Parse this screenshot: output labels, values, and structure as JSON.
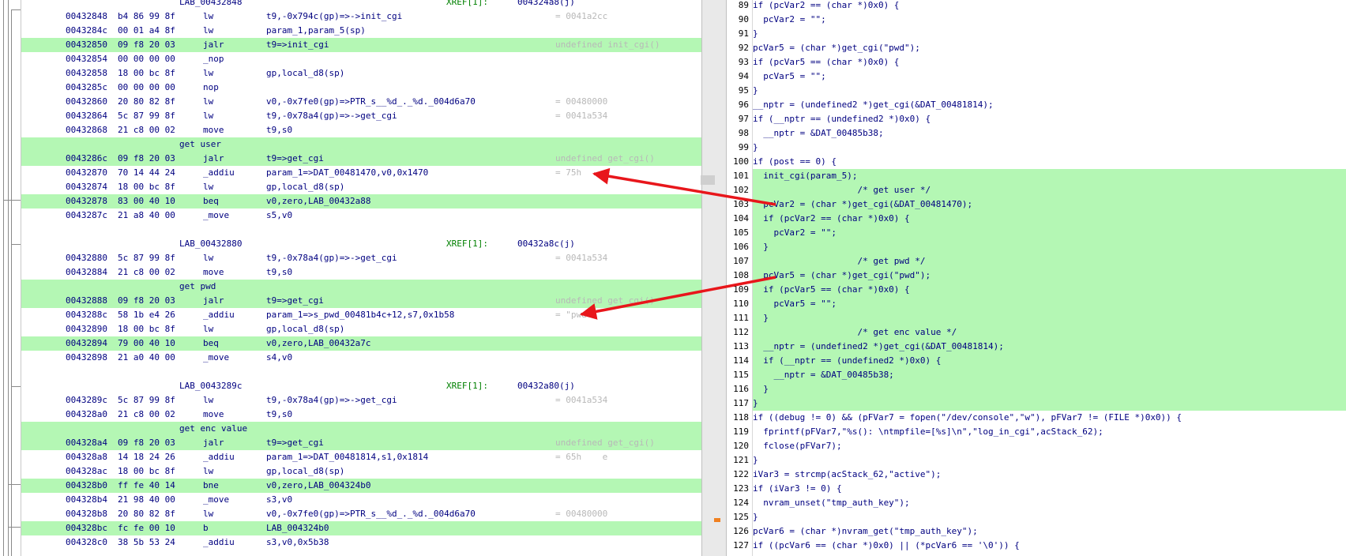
{
  "listing": [
    {
      "type": "label",
      "label": "LAB_00432848",
      "xref": "XREF[1]:",
      "xref_addr": "004324a8(j)"
    },
    {
      "type": "instr",
      "addr": "00432848",
      "bytes": "b4 86 99 8f",
      "mnemonic": "lw",
      "operands": "t9,-0x794c(gp)=>->init_cgi",
      "comment": "= 0041a2cc",
      "hl": false
    },
    {
      "type": "instr",
      "addr": "0043284c",
      "bytes": "00 01 a4 8f",
      "mnemonic": "lw",
      "operands": "param_1,param_5(sp)",
      "comment": "",
      "hl": false
    },
    {
      "type": "instr",
      "addr": "00432850",
      "bytes": "09 f8 20 03",
      "mnemonic": "jalr",
      "operands": "t9=>init_cgi",
      "comment": "undefined init_cgi()",
      "hl": true
    },
    {
      "type": "instr",
      "addr": "00432854",
      "bytes": "00 00 00 00",
      "mnemonic": "_nop",
      "operands": "",
      "comment": "",
      "hl": false
    },
    {
      "type": "instr",
      "addr": "00432858",
      "bytes": "18 00 bc 8f",
      "mnemonic": "lw",
      "operands": "gp,local_d8(sp)",
      "comment": "",
      "hl": false
    },
    {
      "type": "instr",
      "addr": "0043285c",
      "bytes": "00 00 00 00",
      "mnemonic": "nop",
      "operands": "",
      "comment": "",
      "hl": false
    },
    {
      "type": "instr",
      "addr": "00432860",
      "bytes": "20 80 82 8f",
      "mnemonic": "lw",
      "operands": "v0,-0x7fe0(gp)=>PTR_s__%d_._%d._004d6a70",
      "comment": "= 00480000",
      "hl": false
    },
    {
      "type": "instr",
      "addr": "00432864",
      "bytes": "5c 87 99 8f",
      "mnemonic": "lw",
      "operands": "t9,-0x78a4(gp)=>->get_cgi",
      "comment": "= 0041a534",
      "hl": false
    },
    {
      "type": "instr",
      "addr": "00432868",
      "bytes": "21 c8 00 02",
      "mnemonic": "move",
      "operands": "t9,s0",
      "comment": "",
      "hl": false
    },
    {
      "type": "pre",
      "text": "get user",
      "hl": true
    },
    {
      "type": "instr",
      "addr": "0043286c",
      "bytes": "09 f8 20 03",
      "mnemonic": "jalr",
      "operands": "t9=>get_cgi",
      "comment": "undefined get_cgi()",
      "hl": true
    },
    {
      "type": "instr",
      "addr": "00432870",
      "bytes": "70 14 44 24",
      "mnemonic": "_addiu",
      "operands": "param_1=>DAT_00481470,v0,0x1470",
      "comment": "= 75h    u",
      "hl": false
    },
    {
      "type": "instr",
      "addr": "00432874",
      "bytes": "18 00 bc 8f",
      "mnemonic": "lw",
      "operands": "gp,local_d8(sp)",
      "comment": "",
      "hl": false
    },
    {
      "type": "instr",
      "addr": "00432878",
      "bytes": "83 00 40 10",
      "mnemonic": "beq",
      "operands": "v0,zero,LAB_00432a88",
      "comment": "",
      "hl": true
    },
    {
      "type": "instr",
      "addr": "0043287c",
      "bytes": "21 a8 40 00",
      "mnemonic": "_move",
      "operands": "s5,v0",
      "comment": "",
      "hl": false
    },
    {
      "type": "blank"
    },
    {
      "type": "label",
      "label": "LAB_00432880",
      "xref": "XREF[1]:",
      "xref_addr": "00432a8c(j)"
    },
    {
      "type": "instr",
      "addr": "00432880",
      "bytes": "5c 87 99 8f",
      "mnemonic": "lw",
      "operands": "t9,-0x78a4(gp)=>->get_cgi",
      "comment": "= 0041a534",
      "hl": false
    },
    {
      "type": "instr",
      "addr": "00432884",
      "bytes": "21 c8 00 02",
      "mnemonic": "move",
      "operands": "t9,s0",
      "comment": "",
      "hl": false
    },
    {
      "type": "pre",
      "text": "get pwd",
      "hl": true
    },
    {
      "type": "instr",
      "addr": "00432888",
      "bytes": "09 f8 20 03",
      "mnemonic": "jalr",
      "operands": "t9=>get_cgi",
      "comment": "undefined get_cgi()",
      "hl": true
    },
    {
      "type": "instr",
      "addr": "0043288c",
      "bytes": "58 1b e4 26",
      "mnemonic": "_addiu",
      "operands": "param_1=>s_pwd_00481b4c+12,s7,0x1b58",
      "comment": "= \"pwd\"",
      "hl": false
    },
    {
      "type": "instr",
      "addr": "00432890",
      "bytes": "18 00 bc 8f",
      "mnemonic": "lw",
      "operands": "gp,local_d8(sp)",
      "comment": "",
      "hl": false
    },
    {
      "type": "instr",
      "addr": "00432894",
      "bytes": "79 00 40 10",
      "mnemonic": "beq",
      "operands": "v0,zero,LAB_00432a7c",
      "comment": "",
      "hl": true
    },
    {
      "type": "instr",
      "addr": "00432898",
      "bytes": "21 a0 40 00",
      "mnemonic": "_move",
      "operands": "s4,v0",
      "comment": "",
      "hl": false
    },
    {
      "type": "blank"
    },
    {
      "type": "label",
      "label": "LAB_0043289c",
      "xref": "XREF[1]:",
      "xref_addr": "00432a80(j)"
    },
    {
      "type": "instr",
      "addr": "0043289c",
      "bytes": "5c 87 99 8f",
      "mnemonic": "lw",
      "operands": "t9,-0x78a4(gp)=>->get_cgi",
      "comment": "= 0041a534",
      "hl": false
    },
    {
      "type": "instr",
      "addr": "004328a0",
      "bytes": "21 c8 00 02",
      "mnemonic": "move",
      "operands": "t9,s0",
      "comment": "",
      "hl": false
    },
    {
      "type": "pre",
      "text": "get enc value",
      "hl": true
    },
    {
      "type": "instr",
      "addr": "004328a4",
      "bytes": "09 f8 20 03",
      "mnemonic": "jalr",
      "operands": "t9=>get_cgi",
      "comment": "undefined get_cgi()",
      "hl": true
    },
    {
      "type": "instr",
      "addr": "004328a8",
      "bytes": "14 18 24 26",
      "mnemonic": "_addiu",
      "operands": "param_1=>DAT_00481814,s1,0x1814",
      "comment": "= 65h    e",
      "hl": false
    },
    {
      "type": "instr",
      "addr": "004328ac",
      "bytes": "18 00 bc 8f",
      "mnemonic": "lw",
      "operands": "gp,local_d8(sp)",
      "comment": "",
      "hl": false
    },
    {
      "type": "instr",
      "addr": "004328b0",
      "bytes": "ff fe 40 14",
      "mnemonic": "bne",
      "operands": "v0,zero,LAB_004324b0",
      "comment": "",
      "hl": true
    },
    {
      "type": "instr",
      "addr": "004328b4",
      "bytes": "21 98 40 00",
      "mnemonic": "_move",
      "operands": "s3,v0",
      "comment": "",
      "hl": false
    },
    {
      "type": "instr",
      "addr": "004328b8",
      "bytes": "20 80 82 8f",
      "mnemonic": "lw",
      "operands": "v0,-0x7fe0(gp)=>PTR_s__%d_._%d._004d6a70",
      "comment": "= 00480000",
      "hl": false
    },
    {
      "type": "instr",
      "addr": "004328bc",
      "bytes": "fc fe 00 10",
      "mnemonic": "b",
      "operands": "LAB_004324b0",
      "comment": "",
      "hl": true
    },
    {
      "type": "instr",
      "addr": "004328c0",
      "bytes": "38 5b 53 24",
      "mnemonic": "_addiu",
      "operands": "s3,v0,0x5b38",
      "comment": "",
      "hl": false
    }
  ],
  "decompiler": [
    {
      "ln": "89",
      "text": "if (pcVar2 == (char *)0x0) {",
      "hl": false
    },
    {
      "ln": "90",
      "text": "  pcVar2 = \"\";",
      "hl": false
    },
    {
      "ln": "91",
      "text": "}",
      "hl": false
    },
    {
      "ln": "92",
      "text": "pcVar5 = (char *)get_cgi(\"pwd\");",
      "hl": false
    },
    {
      "ln": "93",
      "text": "if (pcVar5 == (char *)0x0) {",
      "hl": false
    },
    {
      "ln": "94",
      "text": "  pcVar5 = \"\";",
      "hl": false
    },
    {
      "ln": "95",
      "text": "}",
      "hl": false
    },
    {
      "ln": "96",
      "text": "__nptr = (undefined2 *)get_cgi(&DAT_00481814);",
      "hl": false
    },
    {
      "ln": "97",
      "text": "if (__nptr == (undefined2 *)0x0) {",
      "hl": false
    },
    {
      "ln": "98",
      "text": "  __nptr = &DAT_00485b38;",
      "hl": false
    },
    {
      "ln": "99",
      "text": "}",
      "hl": false
    },
    {
      "ln": "100",
      "text": "if (post == 0) {",
      "hl": false
    },
    {
      "ln": "101",
      "text": "  init_cgi(param_5);",
      "hl": true
    },
    {
      "ln": "102",
      "text": "                    /* get user */",
      "hl": true
    },
    {
      "ln": "103",
      "text": "  pcVar2 = (char *)get_cgi(&DAT_00481470);",
      "hl": true
    },
    {
      "ln": "104",
      "text": "  if (pcVar2 == (char *)0x0) {",
      "hl": true
    },
    {
      "ln": "105",
      "text": "    pcVar2 = \"\";",
      "hl": true
    },
    {
      "ln": "106",
      "text": "  }",
      "hl": true
    },
    {
      "ln": "107",
      "text": "                    /* get pwd */",
      "hl": true
    },
    {
      "ln": "108",
      "text": "  pcVar5 = (char *)get_cgi(\"pwd\");",
      "hl": true
    },
    {
      "ln": "109",
      "text": "  if (pcVar5 == (char *)0x0) {",
      "hl": true
    },
    {
      "ln": "110",
      "text": "    pcVar5 = \"\";",
      "hl": true
    },
    {
      "ln": "111",
      "text": "  }",
      "hl": true
    },
    {
      "ln": "112",
      "text": "                    /* get enc value */",
      "hl": true
    },
    {
      "ln": "113",
      "text": "  __nptr = (undefined2 *)get_cgi(&DAT_00481814);",
      "hl": true
    },
    {
      "ln": "114",
      "text": "  if (__nptr == (undefined2 *)0x0) {",
      "hl": true
    },
    {
      "ln": "115",
      "text": "    __nptr = &DAT_00485b38;",
      "hl": true
    },
    {
      "ln": "116",
      "text": "  }",
      "hl": true
    },
    {
      "ln": "117",
      "text": "}",
      "hl": true
    },
    {
      "ln": "118",
      "text": "if ((debug != 0) && (pFVar7 = fopen(\"/dev/console\",\"w\"), pFVar7 != (FILE *)0x0)) {",
      "hl": false
    },
    {
      "ln": "119",
      "text": "  fprintf(pFVar7,\"%s(): \\ntmpfile=[%s]\\n\",\"log_in_cgi\",acStack_62);",
      "hl": false
    },
    {
      "ln": "120",
      "text": "  fclose(pFVar7);",
      "hl": false
    },
    {
      "ln": "121",
      "text": "}",
      "hl": false
    },
    {
      "ln": "122",
      "text": "iVar3 = strcmp(acStack_62,\"active\");",
      "hl": false
    },
    {
      "ln": "123",
      "text": "if (iVar3 != 0) {",
      "hl": false
    },
    {
      "ln": "124",
      "text": "  nvram_unset(\"tmp_auth_key\");",
      "hl": false
    },
    {
      "ln": "125",
      "text": "}",
      "hl": false
    },
    {
      "ln": "126",
      "text": "pcVar6 = (char *)nvram_get(\"tmp_auth_key\");",
      "hl": false
    },
    {
      "ln": "127",
      "text": "if ((pcVar6 == (char *)0x0) || (*pcVar6 == '\\0')) {",
      "hl": false
    }
  ],
  "colors": {
    "highlight": "#b4f7b4",
    "arrow": "#e8161b",
    "address": "#000080",
    "label": "#000080",
    "xref": "#008000",
    "comment_gray": "#b8b8b8",
    "operand_ref": "#b000b0"
  }
}
